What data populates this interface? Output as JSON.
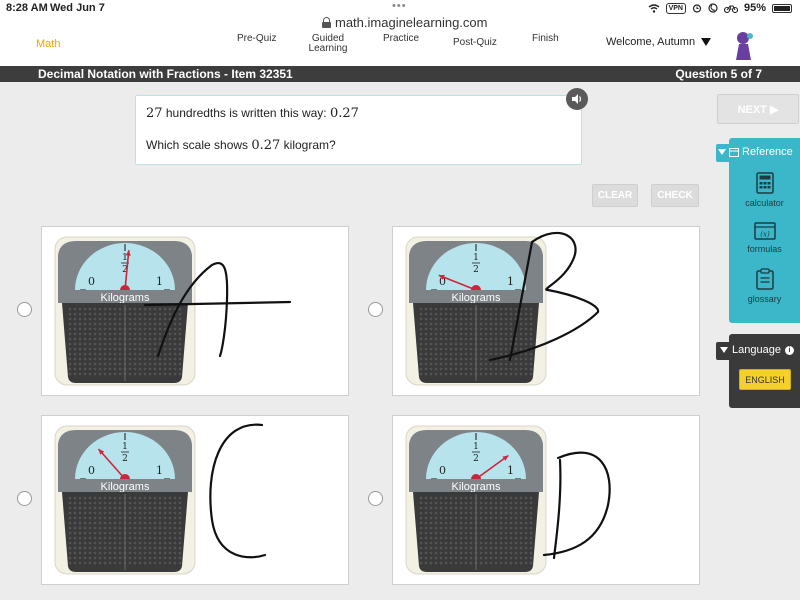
{
  "status": {
    "time": "8:28 AM",
    "date": "Wed Jun 7",
    "dots": "•••",
    "url": "math.imaginelearning.com",
    "vpn": "VPN",
    "battery": "95%"
  },
  "nav": {
    "logo": "Math",
    "items": [
      {
        "label": "Pre-Quiz"
      },
      {
        "label": "Guided Learning"
      },
      {
        "label": "Practice"
      },
      {
        "label": "Post-Quiz"
      },
      {
        "label": "Finish"
      }
    ],
    "welcome": "Welcome, Autumn"
  },
  "titlebar": {
    "title": "Decimal Notation with Fractions - Item 32351",
    "question": "Question 5 of 7"
  },
  "prompt": {
    "line1_num": "27",
    "line1_text": " hundredths is written this way: ",
    "line1_dec": "0.27",
    "line2_pre": "Which scale shows ",
    "line2_dec": "0.27",
    "line2_post": " kilogram?"
  },
  "buttons": {
    "clear": "CLEAR",
    "check": "CHECK",
    "next": "NEXT ▶"
  },
  "scale_labels": {
    "zero": "0",
    "one": "1",
    "half_num": "1",
    "half_den": "2",
    "unit": "Kilograms"
  },
  "options": [
    {
      "id": "A",
      "needle_value": 0.53,
      "handwritten": "A"
    },
    {
      "id": "B",
      "needle_value": 0.12,
      "handwritten": "B"
    },
    {
      "id": "C",
      "needle_value": 0.27,
      "handwritten": "C"
    },
    {
      "id": "D",
      "needle_value": 0.8,
      "handwritten": "D"
    }
  ],
  "reference": {
    "title": "Reference",
    "items": [
      {
        "label": "calculator",
        "icon": "calculator-icon"
      },
      {
        "label": "formulas",
        "icon": "formulas-icon"
      },
      {
        "label": "glossary",
        "icon": "glossary-icon"
      }
    ]
  },
  "language": {
    "title": "Language",
    "info": "i",
    "button": "ENGLISH"
  },
  "colors": {
    "accent_teal": "#3cb7c9",
    "brand_orange": "#f0a500",
    "dial_blue": "#b6e3ec",
    "needle_red": "#d0243b",
    "language_yellow": "#f3d02c"
  }
}
